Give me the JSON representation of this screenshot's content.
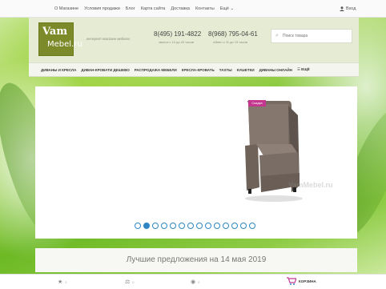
{
  "topbar": {
    "nav": [
      "О Магазине",
      "Условия продажи",
      "Блог",
      "Карта сайта",
      "Доставка",
      "Контакты",
      "Ещё ⌄"
    ],
    "login_label": "Вход"
  },
  "header": {
    "logo_top": "Vam",
    "logo_bottom": "Mebel.ru",
    "tagline": "интернет-магазин мебели",
    "phone1": "8(495) 191-4822",
    "phone1_note": "звонок с 10 до 20 часов",
    "phone2": "8(968) 795-04-61",
    "phone2_note": "обмен с 11 до 19 часов",
    "search_placeholder": "Поиск товара"
  },
  "menu": {
    "items": [
      "ДИВАНЫ И КРЕСЛА",
      "ДИВАН-КРОВАТИ ДЕШЕВО",
      "РАСПРОДАЖА МЕБЕЛИ",
      "КРЕСЛА-КРОВАТЬ",
      "ТАХТЫ",
      "КУШЕТКИ",
      "ДИВАНЫ ОНЛАЙН",
      "☰ ЕЩЁ"
    ]
  },
  "slider": {
    "badge": "Скидка",
    "watermark": "VamMebel.ru",
    "total_slides": 14,
    "active_slide": 2
  },
  "offers": {
    "title": "Лучшие предложения на 14 мая 2019"
  },
  "bottombar": {
    "favorites_count": "0",
    "compare_count": "0",
    "viewed_count": "0",
    "cart_label": "КОРЗИНА"
  },
  "colors": {
    "accent_blue": "#2f86c4",
    "logo_green": "#7d8a2a",
    "sale_pink": "#c4378f"
  }
}
